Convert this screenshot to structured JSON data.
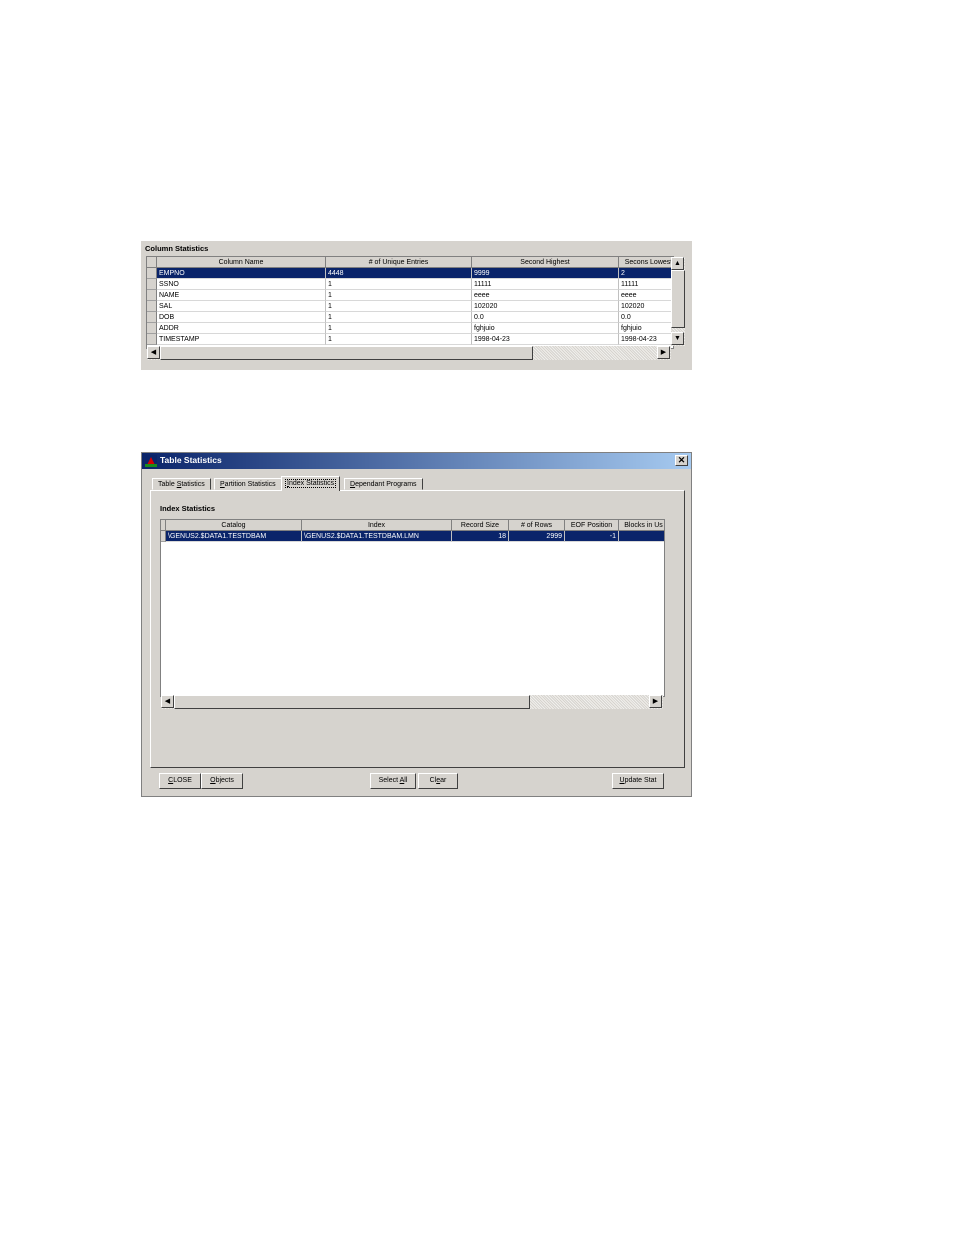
{
  "column_statistics": {
    "title": "Column Statistics",
    "columns": [
      "Column Name",
      "# of Unique Entries",
      "Second Highest",
      "Secons Lowest"
    ],
    "rows": [
      [
        "EMPNO",
        "4448",
        "9999",
        "2"
      ],
      [
        "SSNO",
        "1",
        "11111",
        "11111"
      ],
      [
        "NAME",
        "1",
        "eeee",
        "eeee"
      ],
      [
        "SAL",
        "1",
        "102020",
        "102020"
      ],
      [
        "DOB",
        "1",
        "0.0",
        "0.0"
      ],
      [
        "ADDR",
        "1",
        "fghjuio",
        "fghjuio"
      ],
      [
        "TIMESTAMP",
        "1",
        "1998-04-23",
        "1998-04-23"
      ]
    ],
    "selected_row": 0,
    "scroll_up": "▲",
    "scroll_down": "▼",
    "scroll_left": "◀",
    "scroll_right": "▶"
  },
  "dialog": {
    "title": "Table Statistics",
    "close_glyph": "✕",
    "tabs": [
      {
        "pre": "Table ",
        "u": "S",
        "post": "tatistics"
      },
      {
        "pre": "",
        "u": "P",
        "post": "artition Statistics"
      },
      {
        "pre": "",
        "u": "I",
        "post": "ndex Statistics"
      },
      {
        "pre": "",
        "u": "D",
        "post": "ependant Programs"
      }
    ],
    "active_tab": 2,
    "index_statistics": {
      "title": "Index Statistics",
      "columns": [
        "Catalog",
        "Index",
        "Record Size",
        "# of Rows",
        "EOF Position",
        "Blocks in Us"
      ],
      "rows": [
        [
          "\\GENUS2.$DATA1.TESTDBAM",
          "\\GENUS2.$DATA1.TESTDBAM.LMN",
          "18",
          "2999",
          "-1",
          ""
        ]
      ],
      "scroll_left": "◀",
      "scroll_right": "▶"
    },
    "buttons": {
      "close": {
        "u": "C",
        "post": "LOSE"
      },
      "objects": {
        "u": "O",
        "post": "bjects"
      },
      "select_all": {
        "pre": "Select ",
        "u": "A",
        "post": "ll"
      },
      "clear": {
        "pre": "Cl",
        "u": "e",
        "post": "ar"
      },
      "update_stat": {
        "u": "U",
        "post": "pdate Stat"
      }
    }
  },
  "colors": {
    "selection": "#0a246a",
    "face": "#d6d3ce",
    "titlebar_start": "#0a246a",
    "titlebar_end": "#a6caf0"
  }
}
